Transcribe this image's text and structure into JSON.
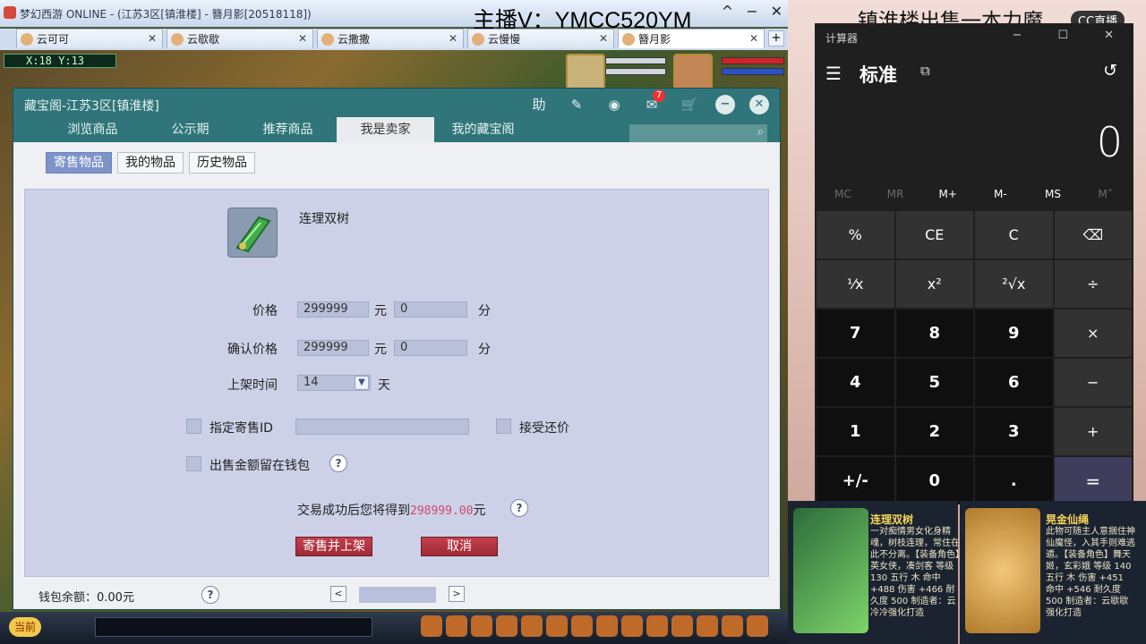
{
  "game": {
    "title": "梦幻西游 ONLINE - (江苏3区[镇淮楼] - 簪月影[20518118])",
    "streamer_text": "主播V：YMCC520YM",
    "window_buttons": [
      "^",
      "−",
      "✕"
    ],
    "tabs": [
      {
        "label": "云可可"
      },
      {
        "label": "云歇歇"
      },
      {
        "label": "云撒撒"
      },
      {
        "label": "云慢慢"
      },
      {
        "label": "簪月影"
      }
    ],
    "coords": "X:18 Y:13"
  },
  "dialog": {
    "title": "藏宝阁-江苏3区[镇淮楼]",
    "badge_count": "7",
    "nav": [
      "浏览商品",
      "公示期",
      "推荐商品",
      "我是卖家",
      "我的藏宝阁"
    ],
    "active_nav": "我是卖家",
    "subtabs": [
      "寄售物品",
      "我的物品",
      "历史物品"
    ],
    "item_name": "连理双树",
    "price_label": "价格",
    "price_yuan": "299999",
    "price_fen": "0",
    "confirm_label": "确认价格",
    "confirm_yuan": "299999",
    "confirm_fen": "0",
    "unit_yuan": "元",
    "unit_fen": "分",
    "list_time_label": "上架时间",
    "list_time_value": "14",
    "unit_day": "天",
    "designated_id_label": "指定寄售ID",
    "accept_counter_label": "接受还价",
    "keep_wallet_label": "出售金额留在钱包",
    "result_prefix": "交易成功后您将得到",
    "result_amount": "298999.00",
    "result_suffix": "元",
    "sell_button": "寄售并上架",
    "cancel_button": "取消",
    "wallet": "钱包余额：0.00元"
  },
  "bottom": {
    "now_button": "当前"
  },
  "calculator": {
    "app_title": "计算器",
    "mode": "标准",
    "display": "0",
    "memory": [
      "MC",
      "MR",
      "M+",
      "M-",
      "MS",
      "M˅"
    ],
    "keys": [
      "%",
      "CE",
      "C",
      "⌫",
      "⅟x",
      "x²",
      "²√x",
      "÷",
      "7",
      "8",
      "9",
      "×",
      "4",
      "5",
      "6",
      "−",
      "1",
      "2",
      "3",
      "+",
      "+/-",
      "0",
      ".",
      "="
    ]
  },
  "overlay": {
    "sell_banner": "镇淮楼出售一本力魔",
    "cc_logo": "CC直播"
  },
  "cards": [
    {
      "title": "连理双树",
      "desc": "一对痴情男女化身精魂，树枝连理，常住在此不分离。【装备角色】英女侠，凑剑客 等级 130 五行 木 命中 +488 伤害 +466 耐久度 500 制造者：云冷冷强化打造"
    },
    {
      "title": "晃金仙绳",
      "desc": "此物可随主人意捆住神仙魔怪，入其手则难逃遁。【装备角色】舞天姬，玄彩娥 等级 140 五行 木 伤害 +451 命中 +546 耐久度 500 制造者：云歇歇强化打造"
    }
  ]
}
